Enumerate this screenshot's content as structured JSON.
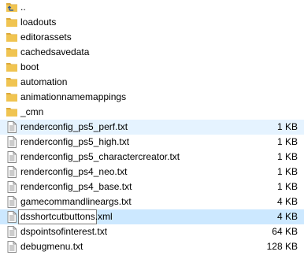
{
  "items": [
    {
      "name": "..",
      "size": "",
      "type": "up"
    },
    {
      "name": "loadouts",
      "size": "",
      "type": "folder"
    },
    {
      "name": "editorassets",
      "size": "",
      "type": "folder"
    },
    {
      "name": "cachedsavedata",
      "size": "",
      "type": "folder"
    },
    {
      "name": "boot",
      "size": "",
      "type": "folder"
    },
    {
      "name": "automation",
      "size": "",
      "type": "folder"
    },
    {
      "name": "animationnamemappings",
      "size": "",
      "type": "folder"
    },
    {
      "name": "_cmn",
      "size": "",
      "type": "folder"
    },
    {
      "name": "renderconfig_ps5_perf.txt",
      "size": "1 KB",
      "type": "file",
      "state": "hover"
    },
    {
      "name": "renderconfig_ps5_high.txt",
      "size": "1 KB",
      "type": "file"
    },
    {
      "name": "renderconfig_ps5_charactercreator.txt",
      "size": "1 KB",
      "type": "file"
    },
    {
      "name": "renderconfig_ps4_neo.txt",
      "size": "1 KB",
      "type": "file"
    },
    {
      "name": "renderconfig_ps4_base.txt",
      "size": "1 KB",
      "type": "file"
    },
    {
      "name": "gamecommandlineargs.txt",
      "size": "4 KB",
      "type": "file"
    },
    {
      "name": "dsshortcutbuttons.xml",
      "size": "4 KB",
      "type": "file",
      "state": "selected-editing"
    },
    {
      "name": "dspointsofinterest.txt",
      "size": "64 KB",
      "type": "file"
    },
    {
      "name": "debugmenu.txt",
      "size": "128 KB",
      "type": "file"
    }
  ],
  "icons": {
    "up": "folder-up-icon",
    "folder": "folder-icon",
    "file": "text-file-icon"
  },
  "colors": {
    "folder": "#f0c451",
    "folder_dark": "#dca93a",
    "hover_bg": "#e5f3ff",
    "selected_bg": "#cce8ff",
    "up_arrow": "#2b5797"
  }
}
